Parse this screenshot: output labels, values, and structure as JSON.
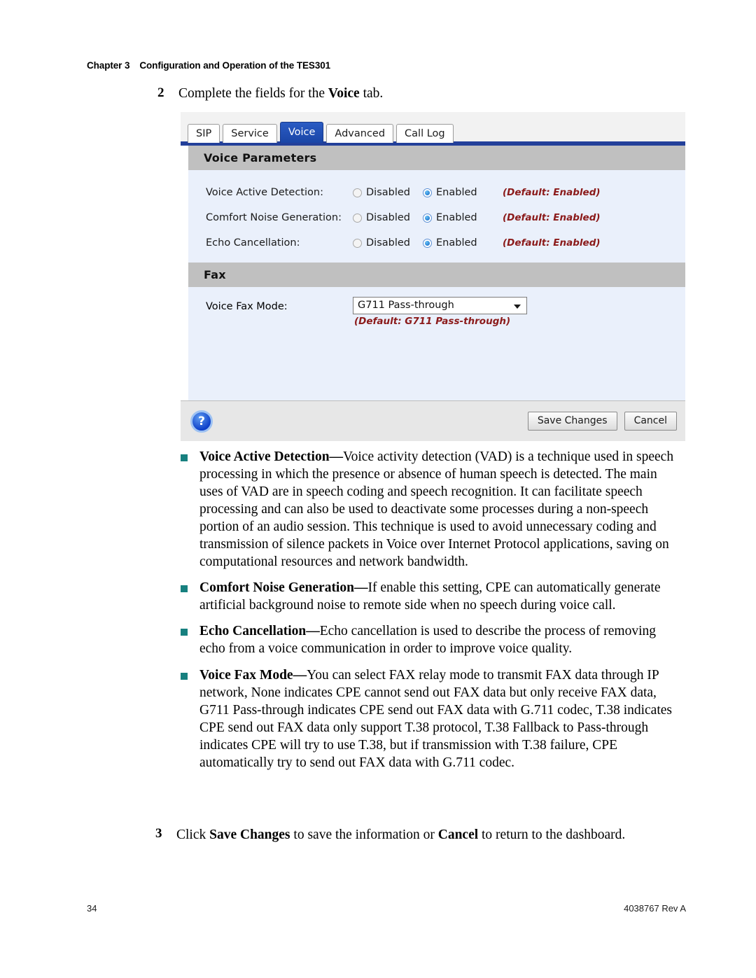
{
  "page": {
    "running_header": {
      "chapter": "Chapter 3",
      "title": "Configuration and Operation of the TES301"
    },
    "footer": {
      "page_number": "34",
      "doc_ref": "4038767 Rev A"
    }
  },
  "steps": {
    "step2": {
      "number": "2",
      "text_before": "Complete the fields for the ",
      "bold": "Voice",
      "text_after": " tab."
    },
    "step3": {
      "number": "3",
      "text_1": "Click ",
      "bold_1": "Save Changes",
      "text_2": " to save the information or ",
      "bold_2": "Cancel",
      "text_3": " to return to the dashboard."
    }
  },
  "screenshot": {
    "tabs": [
      {
        "label": "SIP",
        "active": false
      },
      {
        "label": "Service",
        "active": false
      },
      {
        "label": "Voice",
        "active": true
      },
      {
        "label": "Advanced",
        "active": false
      },
      {
        "label": "Call Log",
        "active": false
      }
    ],
    "sections": [
      {
        "heading": "Voice Parameters"
      },
      {
        "heading": "Fax"
      }
    ],
    "voice_parameters": {
      "heading": "Voice Parameters",
      "rows": [
        {
          "label": "Voice Active Detection:",
          "option_off": "Disabled",
          "option_on": "Enabled",
          "selected": "Enabled",
          "default_note": "(Default: Enabled)"
        },
        {
          "label": "Comfort Noise Generation:",
          "option_off": "Disabled",
          "option_on": "Enabled",
          "selected": "Enabled",
          "default_note": "(Default: Enabled)"
        },
        {
          "label": "Echo Cancellation:",
          "option_off": "Disabled",
          "option_on": "Enabled",
          "selected": "Enabled",
          "default_note": "(Default: Enabled)"
        }
      ]
    },
    "fax": {
      "heading": "Fax",
      "voice_fax_mode": {
        "label": "Voice Fax Mode:",
        "value": "G711 Pass-through",
        "default_note": "(Default: G711 Pass-through)"
      }
    },
    "footer_bar": {
      "help_icon_glyph": "?",
      "save_label": "Save Changes",
      "cancel_label": "Cancel"
    },
    "colors": {
      "active_tab": "#23409a",
      "section_header": "#c0c0c0",
      "form_background": "#eaf0fb",
      "default_note": "#8b1a1a",
      "radio_selected": "#1d7fe0"
    }
  },
  "bullets": [
    {
      "term": "Voice Active Detection",
      "dash": "—",
      "description": "Voice activity detection (VAD) is a technique used in speech processing in which the presence or absence of human speech is detected. The main uses of VAD are in speech coding and speech recognition. It can facilitate speech processing and can also be used to deactivate some processes during a non-speech portion of an audio session. This technique is used to avoid unnecessary coding and transmission of silence packets in Voice over Internet Protocol applications, saving on computational resources and network bandwidth."
    },
    {
      "term": "Comfort Noise Generation",
      "dash": "—",
      "description": "If enable this setting, CPE can automatically generate artificial background noise to remote side when no speech during voice call."
    },
    {
      "term": "Echo Cancellation",
      "dash": "—",
      "description": "Echo cancellation is used to describe the process of removing echo from a voice communication in order to improve voice quality."
    },
    {
      "term": "Voice Fax Mode",
      "dash": "—",
      "description": "You can select FAX relay mode to transmit FAX data through IP network, None indicates CPE cannot send out FAX data but only receive FAX data, G711 Pass-through indicates CPE send out FAX data with G.711 codec, T.38 indicates CPE send out FAX data only support T.38 protocol, T.38 Fallback to Pass-through indicates CPE will try to use T.38, but if transmission with T.38 failure, CPE automatically try to send out FAX data with G.711 codec."
    }
  ],
  "bullet_marker_color": "#17807f"
}
